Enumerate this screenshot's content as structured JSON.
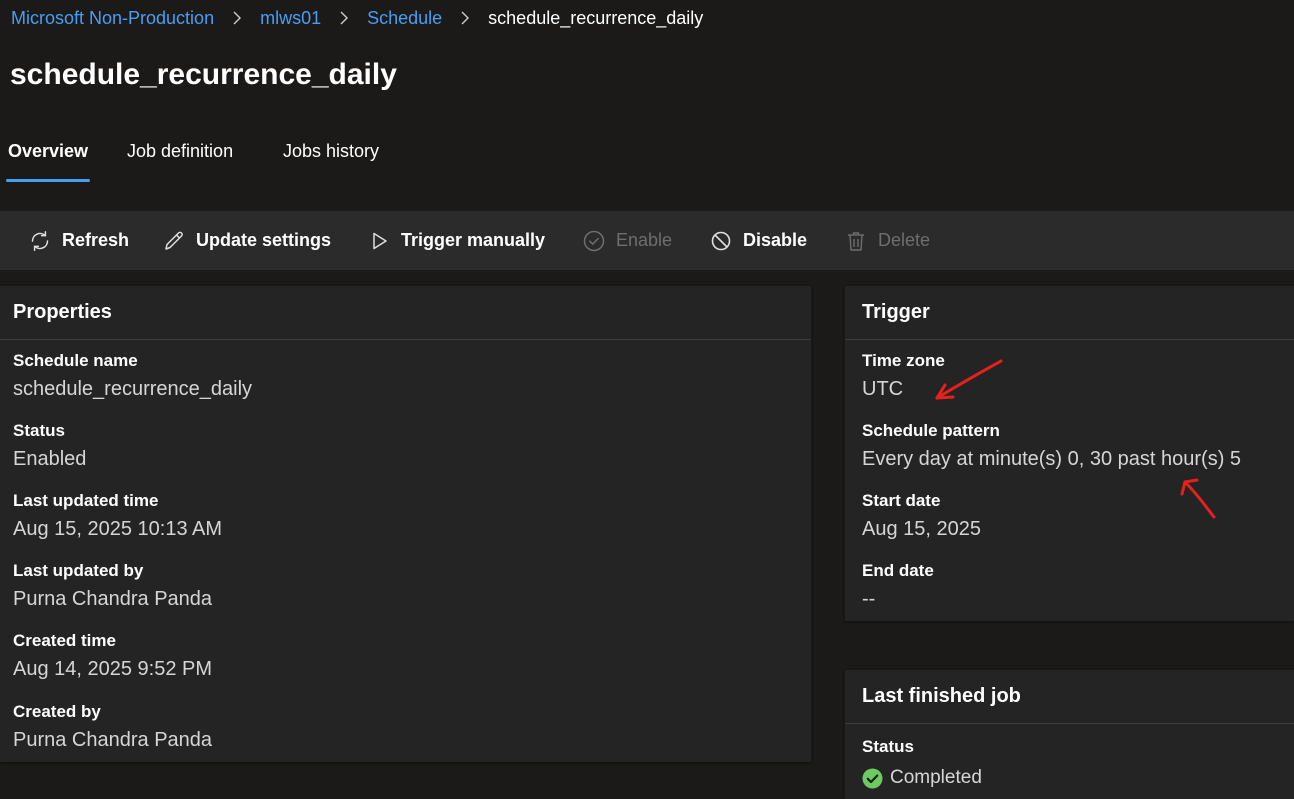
{
  "breadcrumb": {
    "items": [
      "Microsoft Non-Production",
      "mlws01",
      "Schedule"
    ],
    "current": "schedule_recurrence_daily"
  },
  "page": {
    "title": "schedule_recurrence_daily"
  },
  "tabs": [
    "Overview",
    "Job definition",
    "Jobs history"
  ],
  "active_tab": "Overview",
  "toolbar": {
    "refresh": "Refresh",
    "update_settings": "Update settings",
    "trigger_manually": "Trigger manually",
    "enable": "Enable",
    "disable": "Disable",
    "delete": "Delete",
    "disabled_actions": [
      "Enable",
      "Delete"
    ]
  },
  "properties": {
    "title": "Properties",
    "fields": [
      {
        "label": "Schedule name",
        "value": "schedule_recurrence_daily"
      },
      {
        "label": "Status",
        "value": "Enabled"
      },
      {
        "label": "Last updated time",
        "value": "Aug 15, 2025 10:13 AM"
      },
      {
        "label": "Last updated by",
        "value": "Purna Chandra Panda"
      },
      {
        "label": "Created time",
        "value": "Aug 14, 2025 9:52 PM"
      },
      {
        "label": "Created by",
        "value": "Purna Chandra Panda"
      }
    ]
  },
  "trigger": {
    "title": "Trigger",
    "fields": [
      {
        "label": "Time zone",
        "value": "UTC"
      },
      {
        "label": "Schedule pattern",
        "value": "Every day at minute(s) 0, 30 past hour(s) 5"
      },
      {
        "label": "Start date",
        "value": "Aug 15, 2025"
      },
      {
        "label": "End date",
        "value": "--"
      }
    ]
  },
  "last_finished_job": {
    "title": "Last finished job",
    "status_label": "Status",
    "status_value": "Completed"
  },
  "icons": [
    "refresh-icon",
    "edit-icon",
    "play-icon",
    "check-circle-icon",
    "block-icon",
    "trash-icon",
    "chevron-right-icon",
    "success-check-icon"
  ],
  "colors": {
    "background": "#1b1a19",
    "card": "#242424",
    "toolbar": "#2b2b2b",
    "accent": "#479ef5",
    "success": "#6ccb5f",
    "annotation": "#e8201b",
    "disabled_text": "#6e6e6e"
  }
}
